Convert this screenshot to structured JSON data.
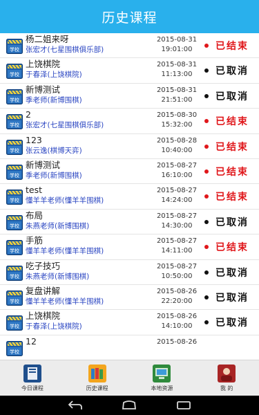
{
  "header": {
    "title": "历史课程"
  },
  "icon_label": "学校",
  "colors": {
    "header_bg": "#29b0ec",
    "ended": "#e0171b",
    "cancelled": "#111111",
    "teacher": "#2b46c2"
  },
  "courses": [
    {
      "name": "杨二姐来呀",
      "teacher": "张宏才(七星围棋俱乐部)",
      "date": "2015-08-31",
      "time": "19:01:00",
      "status": "已结束",
      "state": "ended"
    },
    {
      "name": "上饶棋院",
      "teacher": "于春泽(上饶棋院)",
      "date": "2015-08-31",
      "time": "11:13:00",
      "status": "已取消",
      "state": "cancelled"
    },
    {
      "name": "新博测试",
      "teacher": "季老师(新博围棋)",
      "date": "2015-08-31",
      "time": "21:51:00",
      "status": "已取消",
      "state": "cancelled"
    },
    {
      "name": "2",
      "teacher": "张宏才(七星围棋俱乐部)",
      "date": "2015-08-30",
      "time": "15:32:00",
      "status": "已结束",
      "state": "ended"
    },
    {
      "name": "123",
      "teacher": "张云逸(棋博天弈)",
      "date": "2015-08-28",
      "time": "10:40:00",
      "status": "已结束",
      "state": "ended"
    },
    {
      "name": "新博测试",
      "teacher": "季老师(新博围棋)",
      "date": "2015-08-27",
      "time": "16:10:00",
      "status": "已结束",
      "state": "ended"
    },
    {
      "name": "test",
      "teacher": "懂羊羊老师(懂羊羊围棋)",
      "date": "2015-08-27",
      "time": "14:24:00",
      "status": "已结束",
      "state": "ended"
    },
    {
      "name": "布局",
      "teacher": "朱燕老师(新博围棋)",
      "date": "2015-08-27",
      "time": "14:30:00",
      "status": "已取消",
      "state": "cancelled"
    },
    {
      "name": "手筋",
      "teacher": "懂羊羊老师(懂羊羊围棋)",
      "date": "2015-08-27",
      "time": "14:11:00",
      "status": "已结束",
      "state": "ended"
    },
    {
      "name": "吃子技巧",
      "teacher": "朱燕老师(新博围棋)",
      "date": "2015-08-27",
      "time": "10:50:00",
      "status": "已取消",
      "state": "cancelled"
    },
    {
      "name": "复盘讲解",
      "teacher": "懂羊羊老师(懂羊羊围棋)",
      "date": "2015-08-26",
      "time": "22:20:00",
      "status": "已取消",
      "state": "cancelled"
    },
    {
      "name": "上饶棋院",
      "teacher": "于春泽(上饶棋院)",
      "date": "2015-08-26",
      "time": "14:10:00",
      "status": "已取消",
      "state": "cancelled"
    },
    {
      "name": "12",
      "teacher": "",
      "date": "2015-08-26",
      "time": "",
      "status": "",
      "state": "partial"
    }
  ],
  "tabs": [
    {
      "label": "今日课程",
      "icon": "book-icon",
      "color": "#1f4f8c"
    },
    {
      "label": "历史课程",
      "icon": "history-books-icon",
      "color": "#f3a51d"
    },
    {
      "label": "本地资源",
      "icon": "local-resources-icon",
      "color": "#2f8a3c"
    },
    {
      "label": "我 的",
      "icon": "profile-icon",
      "color": "#a82525"
    }
  ],
  "nav": [
    "back-icon",
    "home-icon",
    "recent-apps-icon"
  ]
}
